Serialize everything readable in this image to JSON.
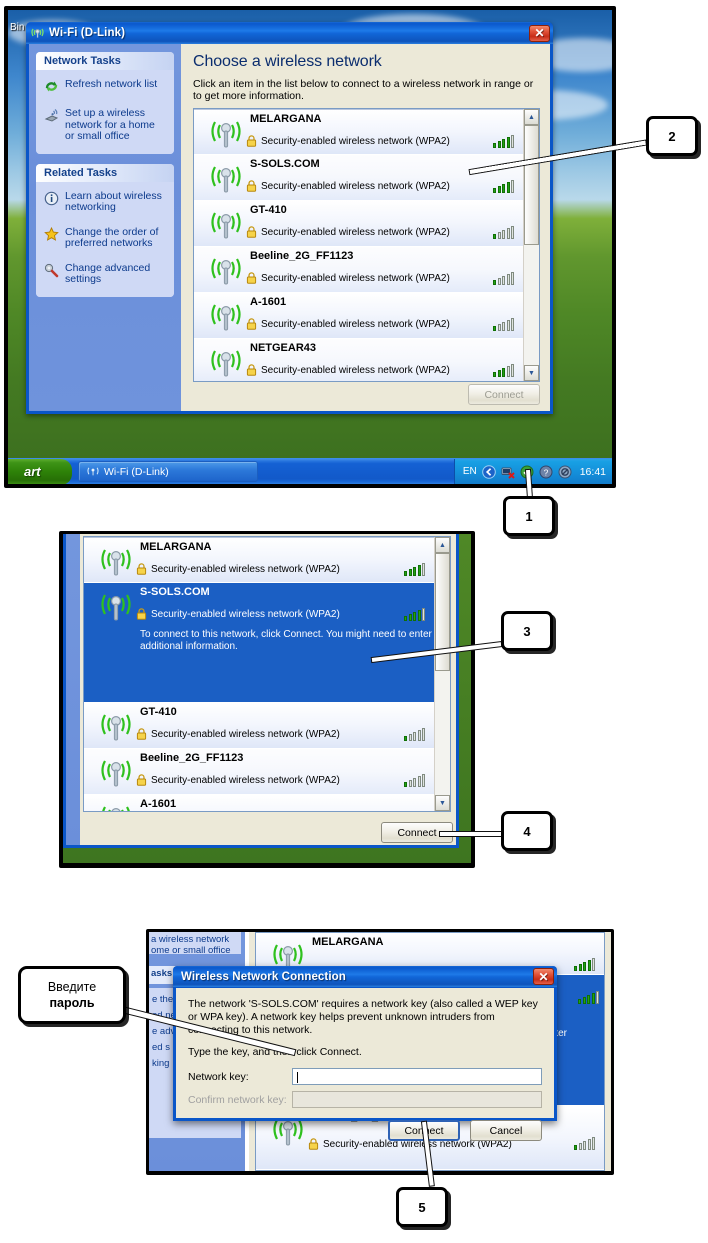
{
  "shot1": {
    "desktop_icon_label": "Bin",
    "window": {
      "title": "Wi-Fi (D-Link)",
      "title_icon": "wireless-icon",
      "close_label": "✕"
    },
    "sidebar": {
      "panels": [
        {
          "header": "Network Tasks",
          "items": [
            {
              "icon": "refresh-icon",
              "label": "Refresh network list"
            },
            {
              "icon": "setup-wizard-icon",
              "label": "Set up a wireless network for a home or small office"
            }
          ]
        },
        {
          "header": "Related Tasks",
          "items": [
            {
              "icon": "info-icon",
              "label": "Learn about wireless networking"
            },
            {
              "icon": "star-icon",
              "label": "Change the order of preferred networks"
            },
            {
              "icon": "wrench-icon",
              "label": "Change advanced settings"
            }
          ]
        }
      ]
    },
    "main": {
      "heading": "Choose a wireless network",
      "subtext": "Click an item in the list below to connect to a wireless network in range or to get more information.",
      "networks": [
        {
          "ssid": "MELARGANA",
          "security": "Security-enabled wireless network (WPA2)",
          "signal": 4
        },
        {
          "ssid": "S-SOLS.COM",
          "security": "Security-enabled wireless network (WPA2)",
          "signal": 4
        },
        {
          "ssid": "GT-410",
          "security": "Security-enabled wireless network (WPA2)",
          "signal": 1
        },
        {
          "ssid": "Beeline_2G_FF1123",
          "security": "Security-enabled wireless network (WPA2)",
          "signal": 1
        },
        {
          "ssid": "A-1601",
          "security": "Security-enabled wireless network (WPA2)",
          "signal": 1
        },
        {
          "ssid": "NETGEAR43",
          "security": "Security-enabled wireless network (WPA2)",
          "signal": 3
        }
      ],
      "connect_label": "Connect"
    },
    "taskbar": {
      "start_label": "art",
      "task_button": "Wi-Fi (D-Link)",
      "tray_language": "EN",
      "tray_icons": [
        "chevron-left-icon",
        "network-disconnected-icon",
        "security-icon",
        "help-icon",
        "shield-icon"
      ],
      "clock": "16:41"
    }
  },
  "shot2": {
    "networks": [
      {
        "ssid": "MELARGANA",
        "security": "Security-enabled wireless network (WPA2)",
        "signal": 4,
        "selected": false
      },
      {
        "ssid": "S-SOLS.COM",
        "security": "Security-enabled wireless network (WPA2)",
        "signal": 4,
        "selected": true,
        "hint": "To connect to this network, click Connect. You might need to enter additional information."
      },
      {
        "ssid": "GT-410",
        "security": "Security-enabled wireless network (WPA2)",
        "signal": 1,
        "selected": false
      },
      {
        "ssid": "Beeline_2G_FF1123",
        "security": "Security-enabled wireless network (WPA2)",
        "signal": 1,
        "selected": false
      },
      {
        "ssid": "A-1601",
        "security": "",
        "signal": 0,
        "selected": false
      }
    ],
    "connect_label": "Connect"
  },
  "shot3": {
    "background": {
      "sidebar_lines": [
        "a wireless network",
        "ome or small office",
        "asks",
        "e the",
        "ed ne",
        "e adv",
        "ed s",
        "king"
      ],
      "right_edge_text": "nter",
      "networks": [
        {
          "ssid": "MELARGANA",
          "signal": 4
        },
        {
          "ssid": "Beeline_2G_FF1123",
          "security": "Security-enabled wireless network (WPA2)",
          "signal": 1
        }
      ]
    },
    "dialog": {
      "title": "Wireless Network Connection",
      "close_label": "✕",
      "body_line1": "The network 'S-SOLS.COM' requires a network key (also called a WEP key or WPA key). A network key helps prevent unknown intruders from connecting to this network.",
      "body_line2": "Type the key, and then click Connect.",
      "key_label": "Network key:",
      "key_value": "",
      "confirm_label": "Confirm network key:",
      "confirm_value": "",
      "connect_label": "Connect",
      "cancel_label": "Cancel"
    },
    "callout_ru": {
      "line1": "Введите",
      "line2": "пароль"
    }
  },
  "callouts": {
    "one": "1",
    "two": "2",
    "three": "3",
    "four": "4",
    "five": "5"
  },
  "colors": {
    "xp_blue": "#0a56c8",
    "selection_blue": "#1b5fc4",
    "face": "#ece9d8",
    "sidebar_blue": "#6f93dc",
    "signal_green": "#22a315",
    "close_red": "#c72d18"
  }
}
